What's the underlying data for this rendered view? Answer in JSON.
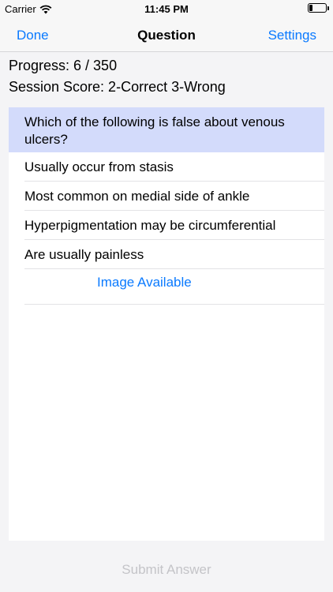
{
  "status_bar": {
    "carrier": "Carrier",
    "time": "11:45 PM",
    "battery_level": 0.2
  },
  "nav": {
    "left_label": "Done",
    "title": "Question",
    "right_label": "Settings"
  },
  "info": {
    "progress": "Progress: 6 / 350",
    "score": "Session Score: 2-Correct 3-Wrong"
  },
  "question": {
    "text": "Which of the following is false about venous ulcers?"
  },
  "answers": [
    "Usually occur from stasis",
    "Most common on medial side of ankle",
    "Hyperpigmentation may be circumferential",
    "Are usually painless"
  ],
  "image_link": "Image Available",
  "submit_label": "Submit Answer",
  "colors": {
    "accent": "#0a7aff",
    "question_bg": "#d3dbfb",
    "disabled_text": "#c4c4c8"
  },
  "icons": {
    "wifi": "wifi-icon",
    "battery": "battery-icon"
  }
}
